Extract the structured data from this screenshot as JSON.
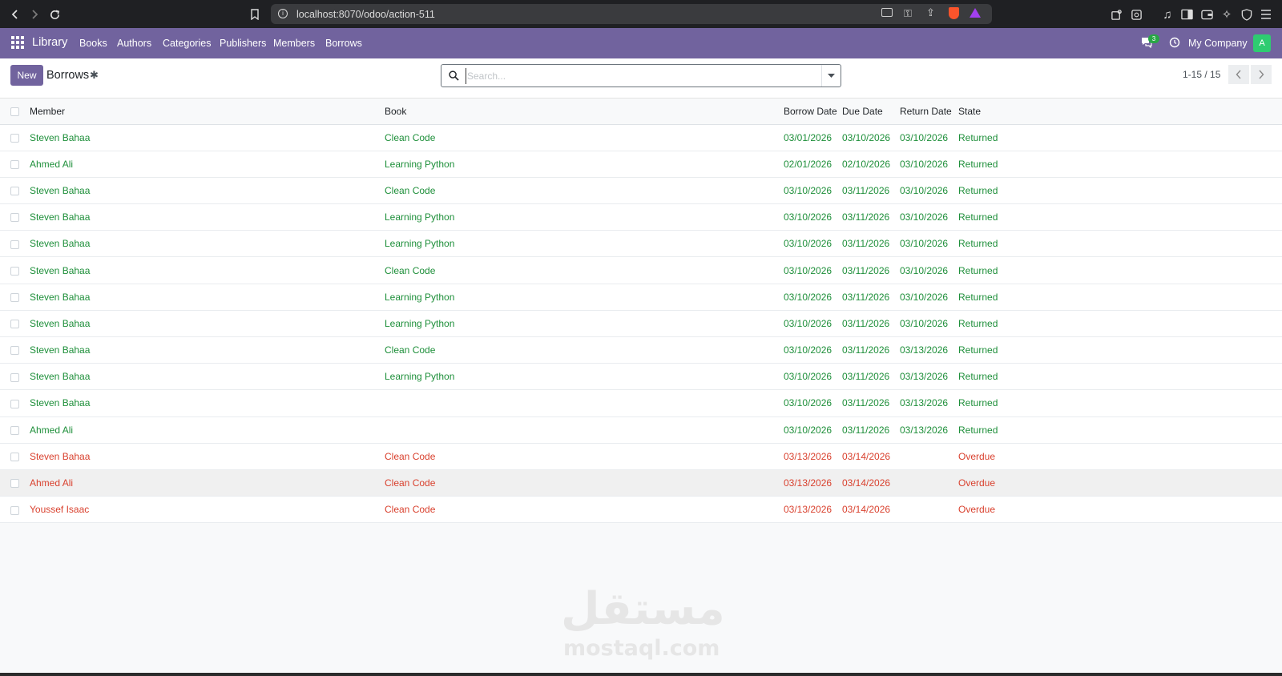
{
  "browser": {
    "url": "localhost:8070/odoo/action-511"
  },
  "navbar": {
    "app_name": "Library",
    "menu": [
      "Books",
      "Authors",
      "Categories",
      "Publishers",
      "Members",
      "Borrows"
    ],
    "message_badge": "3",
    "company": "My Company",
    "avatar_letter": "A"
  },
  "control_panel": {
    "new_label": "New",
    "title": "Borrows",
    "search_placeholder": "Search...",
    "pager": "1-15 / 15"
  },
  "table": {
    "headers": [
      "Member",
      "Book",
      "Borrow Date",
      "Due Date",
      "Return Date",
      "State"
    ],
    "rows": [
      {
        "member": "Steven Bahaa",
        "book": "Clean Code",
        "borrow_date": "03/01/2026",
        "due_date": "03/10/2026",
        "return_date": "03/10/2026",
        "state": "Returned"
      },
      {
        "member": "Ahmed Ali",
        "book": "Learning Python",
        "borrow_date": "02/01/2026",
        "due_date": "02/10/2026",
        "return_date": "03/10/2026",
        "state": "Returned"
      },
      {
        "member": "Steven Bahaa",
        "book": "Clean Code",
        "borrow_date": "03/10/2026",
        "due_date": "03/11/2026",
        "return_date": "03/10/2026",
        "state": "Returned"
      },
      {
        "member": "Steven Bahaa",
        "book": "Learning Python",
        "borrow_date": "03/10/2026",
        "due_date": "03/11/2026",
        "return_date": "03/10/2026",
        "state": "Returned"
      },
      {
        "member": "Steven Bahaa",
        "book": "Learning Python",
        "borrow_date": "03/10/2026",
        "due_date": "03/11/2026",
        "return_date": "03/10/2026",
        "state": "Returned"
      },
      {
        "member": "Steven Bahaa",
        "book": "Clean Code",
        "borrow_date": "03/10/2026",
        "due_date": "03/11/2026",
        "return_date": "03/10/2026",
        "state": "Returned"
      },
      {
        "member": "Steven Bahaa",
        "book": "Learning Python",
        "borrow_date": "03/10/2026",
        "due_date": "03/11/2026",
        "return_date": "03/10/2026",
        "state": "Returned"
      },
      {
        "member": "Steven Bahaa",
        "book": "Learning Python",
        "borrow_date": "03/10/2026",
        "due_date": "03/11/2026",
        "return_date": "03/10/2026",
        "state": "Returned"
      },
      {
        "member": "Steven Bahaa",
        "book": "Clean Code",
        "borrow_date": "03/10/2026",
        "due_date": "03/11/2026",
        "return_date": "03/13/2026",
        "state": "Returned"
      },
      {
        "member": "Steven Bahaa",
        "book": "Learning Python",
        "borrow_date": "03/10/2026",
        "due_date": "03/11/2026",
        "return_date": "03/13/2026",
        "state": "Returned"
      },
      {
        "member": "Steven Bahaa",
        "book": "",
        "borrow_date": "03/10/2026",
        "due_date": "03/11/2026",
        "return_date": "03/13/2026",
        "state": "Returned"
      },
      {
        "member": "Ahmed Ali",
        "book": "",
        "borrow_date": "03/10/2026",
        "due_date": "03/11/2026",
        "return_date": "03/13/2026",
        "state": "Returned"
      },
      {
        "member": "Steven Bahaa",
        "book": "Clean Code",
        "borrow_date": "03/13/2026",
        "due_date": "03/14/2026",
        "return_date": "",
        "state": "Overdue"
      },
      {
        "member": "Ahmed Ali",
        "book": "Clean Code",
        "borrow_date": "03/13/2026",
        "due_date": "03/14/2026",
        "return_date": "",
        "state": "Overdue"
      },
      {
        "member": "Youssef Isaac",
        "book": "Clean Code",
        "borrow_date": "03/13/2026",
        "due_date": "03/14/2026",
        "return_date": "",
        "state": "Overdue"
      }
    ]
  },
  "watermark": {
    "arabic": "مستقل",
    "latin": "mostaql.com"
  },
  "colors": {
    "brand": "#71639e",
    "returned": "#1e8f3a",
    "overdue": "#d9412e"
  }
}
